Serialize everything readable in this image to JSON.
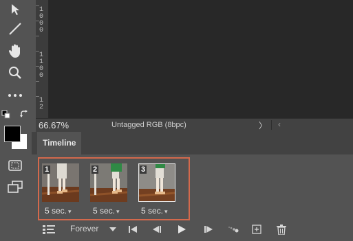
{
  "ruler": {
    "marks": [
      "1\n0\n0\n0",
      "1\n1\n0\n0",
      "1\n2"
    ]
  },
  "status": {
    "zoom": "66.67%",
    "doc_info": "Untagged RGB (8bpc)",
    "next_arrow": "〉",
    "prev_arrow": "‹"
  },
  "timeline": {
    "tab_label": "Timeline",
    "frames": [
      {
        "number": "1",
        "delay": "5 sec.",
        "selected": false
      },
      {
        "number": "2",
        "delay": "5 sec.",
        "selected": false
      },
      {
        "number": "3",
        "delay": "5 sec.",
        "selected": true
      }
    ],
    "loop_option": "Forever"
  },
  "tools": [
    "move-tool-icon",
    "line-tool-icon",
    "hand-tool-icon",
    "zoom-tool-icon",
    "more-tools-icon",
    "swap-colors-icon",
    "quick-mask-icon",
    "screen-mode-icon"
  ],
  "colors": {
    "highlight": "#d4694c",
    "canvas": "#282828",
    "panel": "#535353"
  }
}
